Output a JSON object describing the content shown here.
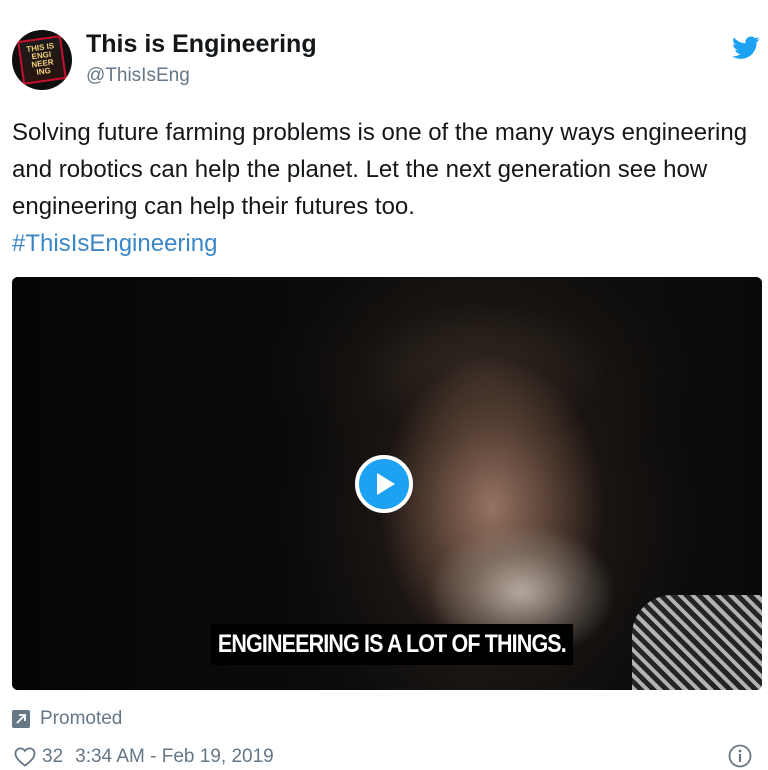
{
  "author": {
    "display_name": "This is Engineering",
    "handle": "@ThisIsEng",
    "avatar_lines": [
      "THIS IS",
      "ENGI",
      "NEER",
      "ING"
    ]
  },
  "tweet": {
    "text": "Solving future farming problems is one of the many ways engineering and robotics can help the planet. Let the next generation see how engineering can help their futures too.",
    "hashtag": "#ThisIsEngineering"
  },
  "media": {
    "caption": "ENGINEERING IS A LOT OF THINGS.",
    "play_icon": "play-icon"
  },
  "footer": {
    "promoted_label": "Promoted",
    "like_count": "32",
    "timestamp": "3:34 AM - Feb 19, 2019"
  },
  "colors": {
    "brand_blue": "#1da1f2",
    "hashtag_blue": "#3b87c6",
    "muted_gray": "#657786"
  },
  "icons": [
    "twitter-bird-icon",
    "play-icon",
    "promoted-arrow-icon",
    "heart-icon",
    "info-icon"
  ]
}
